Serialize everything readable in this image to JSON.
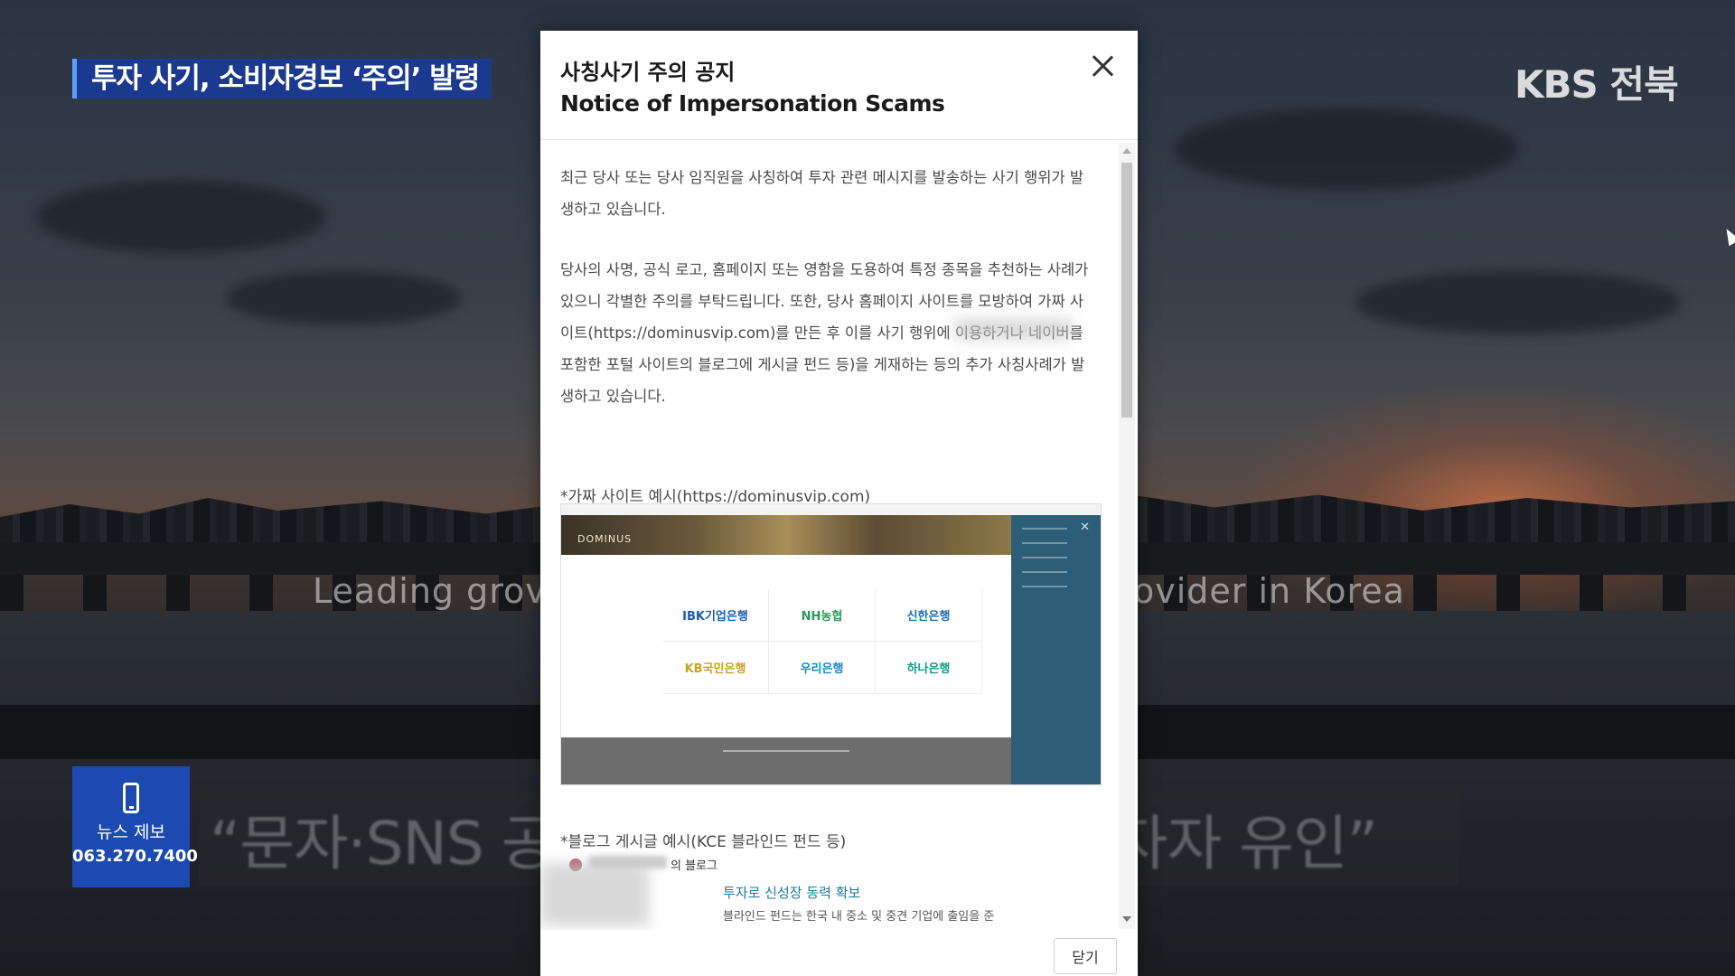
{
  "broadcast": {
    "headline": "투자 사기, 소비자경보 ‘주의’ 발령",
    "channel_logo": "KBS 전북",
    "bg_subtitle_left": "Leading grov",
    "bg_subtitle_right": "ovider in Korea",
    "quote": "“문자·SNS 공  주소·사이트 주소로 투자자 유인”",
    "news_tip": {
      "label": "뉴스 제보",
      "phone": "063.270.7400"
    }
  },
  "modal": {
    "title_ko": "사칭사기 주의 공지",
    "title_en": "Notice of Impersonation Scams",
    "paragraph1": "최근 당사 또는 당사 임직원을 사칭하여 투자 관련 메시지를 발송하는 사기 행위가 발생하고 있습니다.",
    "paragraph2": "당사의 사명, 공식 로고, 홈페이지 또는 영함을 도용하여 특정 종목을 추천하는 사례가 있으니 각별한 주의를 부탁드립니다. 또한, 당사 홈페이지 사이트를 모방하여 가짜 사이트(https://dominusvip.com)를 만든 후 이를 사기 행위에 이용하거나 네이버를 포함한 포털 사이트의 블로그에 게시글 펀드 등)을 게재하는 등의 추가 사칭사례가 발생하고 있습니다.",
    "fake_site_label": "*가짜 사이트 예시(https://dominusvip.com)",
    "fake_site": {
      "brand": "DOMINUS",
      "banks": [
        "IBK기업은행",
        "NH농협",
        "신한은행",
        "KB국민은행",
        "우리은행",
        "하나은행"
      ],
      "bank_colors": [
        "#1d5ab8",
        "#2b9a5a",
        "#1a6fb5",
        "#c9a22a",
        "#1c86c8",
        "#149a87"
      ]
    },
    "blog_label": "*블로그 게시글 예시(KCE 블라인드 펀드 등)",
    "blog_preview": {
      "author_suffix": "의 블로그",
      "title": "투자로 신성장 동력 확보",
      "snippet": "블라인드 펀드는 한국 내 중소 및 중견 기업에 출임을 준"
    },
    "close_button": "닫기"
  }
}
